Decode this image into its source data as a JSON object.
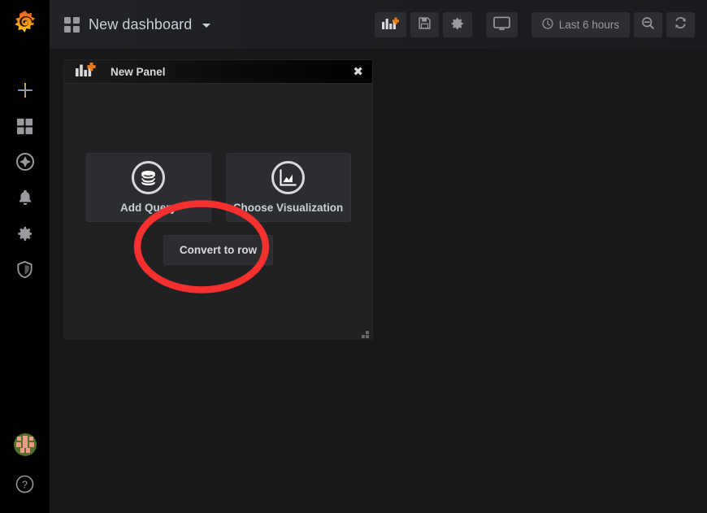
{
  "app": {
    "brand_icon": "grafana-logo",
    "background": "#161719"
  },
  "sidebar": {
    "items": [
      {
        "name": "create",
        "icon": "plus-icon",
        "label": "Create"
      },
      {
        "name": "dashboards",
        "icon": "dashboards-grid-icon",
        "label": "Dashboards"
      },
      {
        "name": "explore",
        "icon": "compass-icon",
        "label": "Explore"
      },
      {
        "name": "alerting",
        "icon": "bell-icon",
        "label": "Alerting"
      },
      {
        "name": "configuration",
        "icon": "gear-icon",
        "label": "Configuration"
      },
      {
        "name": "server-admin",
        "icon": "shield-icon",
        "label": "Server Admin"
      }
    ],
    "bottom": [
      {
        "name": "user-avatar",
        "icon": "avatar-icon",
        "label": "User"
      },
      {
        "name": "help",
        "icon": "question-circle-icon",
        "label": "Help"
      }
    ]
  },
  "navbar": {
    "dashboard_icon": "dashboards-grid-icon",
    "title": "New dashboard",
    "caret": "chevron-down-icon",
    "buttons": [
      {
        "name": "add-panel",
        "icon": "add-panel-icon",
        "title": "Add panel"
      },
      {
        "name": "save-dashboard",
        "icon": "save-floppy-icon",
        "title": "Save dashboard"
      },
      {
        "name": "dashboard-settings",
        "icon": "gear-icon",
        "title": "Dashboard settings"
      },
      {
        "name": "cycle-view-mode",
        "icon": "monitor-icon",
        "title": "Cycle view mode"
      }
    ],
    "time_picker": {
      "icon": "clock-icon",
      "label": "Last 6 hours"
    },
    "zoom_out": {
      "name": "zoom-out",
      "icon": "search-minus-icon",
      "title": "Zoom out time range"
    },
    "refresh": {
      "name": "refresh",
      "icon": "refresh-icon",
      "title": "Refresh dashboard"
    }
  },
  "panel": {
    "icon": "add-panel-icon",
    "title": "New Panel",
    "close_label": "✖",
    "placeholders": [
      {
        "name": "add-query",
        "icon": "database-icon",
        "label": "Add Query"
      },
      {
        "name": "choose-visualization",
        "icon": "area-chart-icon",
        "label": "Choose Visualization"
      }
    ],
    "convert_to_row_label": "Convert to row"
  },
  "annotation": {
    "shape": "ellipse",
    "color": "#f62f2f",
    "stroke_width": 8,
    "targets": "add-query"
  },
  "colors": {
    "page_background": "#161719",
    "panel_background": "#212124",
    "sidebar_background": "#000000",
    "accent_orange": "#eb7b18",
    "text_primary": "#d8d9da",
    "text_link": "#c7d0d9",
    "annotation_red": "#f62f2f"
  }
}
